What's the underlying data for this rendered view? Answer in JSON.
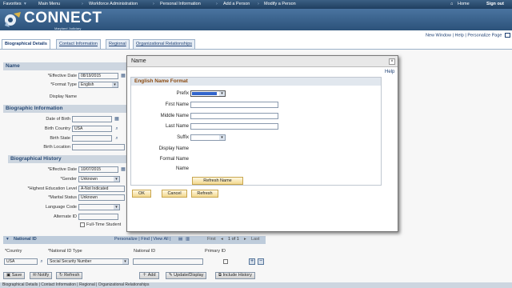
{
  "topnav": {
    "favorites": "Favorites",
    "main_menu": "Main Menu",
    "workforce": "Workforce Administration",
    "personal_info": "Personal Information",
    "add_person": "Add a Person",
    "modify_person": "Modify a Person",
    "home": "Home",
    "sign_out": "Sign out"
  },
  "banner": {
    "logo_text": "CONNECT",
    "logo_sub": "Maryland Judiciary"
  },
  "links": {
    "new_window": "New Window",
    "help": "Help",
    "personalize": "Personalize Page"
  },
  "tabs": [
    "Biographical Details",
    "Contact Information",
    "Regional",
    "Organizational Relationships"
  ],
  "name_section": {
    "header": "Name",
    "effective_date_label": "*Effective Date",
    "effective_date": "08/19/2015",
    "format_type_label": "*Format Type",
    "format_type": "English",
    "display_name_label": "Display Name"
  },
  "bio_info": {
    "header": "Biographic Information",
    "dob_label": "Date of Birth",
    "birth_country_label": "Birth Country",
    "birth_country": "USA",
    "birth_state_label": "Birth State",
    "birth_location_label": "Birth Location"
  },
  "bio_history": {
    "header": "Biographical History",
    "effective_date_label": "*Effective Date",
    "effective_date": "10/07/2015",
    "gender_label": "*Gender",
    "gender": "Unknown",
    "education_label": "*Highest Education Level",
    "education": "A-Not Indicated",
    "marital_label": "*Marital Status",
    "marital": "Unknown",
    "language_label": "Language Code",
    "alternate_label": "Alternate ID",
    "fulltime_label": "Full-Time Student"
  },
  "national_id": {
    "header": "National ID",
    "nav_links": "Personalize | Find | View All |",
    "first": "First",
    "count": "1 of 1",
    "last": "Last",
    "col_country": "*Country",
    "col_type": "*National ID Type",
    "col_id": "National ID",
    "col_primary": "Primary ID",
    "row_country": "USA",
    "row_type": "Social Security Number"
  },
  "buttons": {
    "save": "Save",
    "notify": "Notify",
    "refresh": "Refresh",
    "add": "Add",
    "update_display": "Update/Display",
    "include_history": "Include History"
  },
  "footer": "Biographical Details | Contact Information | Regional | Organizational Relationships",
  "modal": {
    "title": "Name",
    "help": "Help",
    "section": "English Name Format",
    "prefix_label": "Prefix",
    "first_label": "First Name",
    "middle_label": "Middle Name",
    "last_label": "Last Name",
    "suffix_label": "Suffix",
    "display_label": "Display Name",
    "formal_label": "Formal Name",
    "name_label": "Name",
    "refresh_name": "Refresh Name",
    "ok": "OK",
    "cancel": "Cancel",
    "refresh": "Refresh"
  }
}
